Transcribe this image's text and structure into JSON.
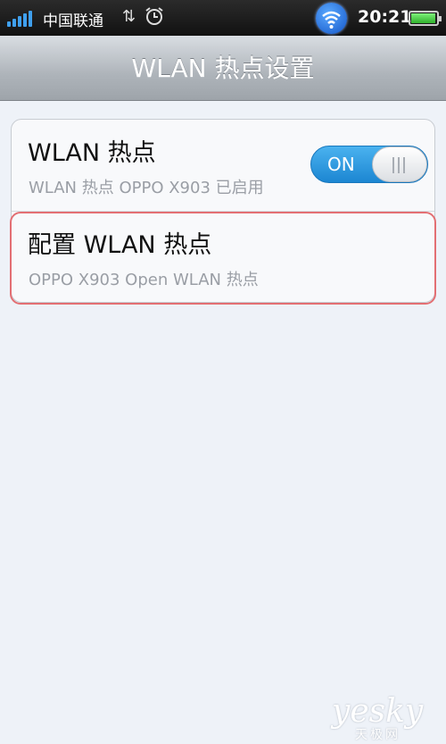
{
  "status_bar": {
    "carrier": "中国联通",
    "time": "20:21",
    "battery_level": 0.95,
    "signal_bars": 5,
    "icons": [
      "signal-icon",
      "usb-debug-icon",
      "alarm-icon",
      "wifi-hotspot-icon",
      "battery-icon"
    ]
  },
  "title_bar": {
    "title": "WLAN 热点设置"
  },
  "settings": {
    "hotspot": {
      "title": "WLAN 热点",
      "subtitle": "WLAN 热点 OPPO X903 已启用",
      "toggle_label": "ON",
      "toggle_on": true
    },
    "configure": {
      "title": "配置 WLAN 热点",
      "subtitle": "OPPO X903 Open WLAN 热点"
    }
  },
  "watermark": {
    "brand": "yesky",
    "sub": "天极网"
  },
  "colors": {
    "accent": "#1c86d2",
    "highlight": "#e36f73",
    "background": "#eef2f8"
  }
}
